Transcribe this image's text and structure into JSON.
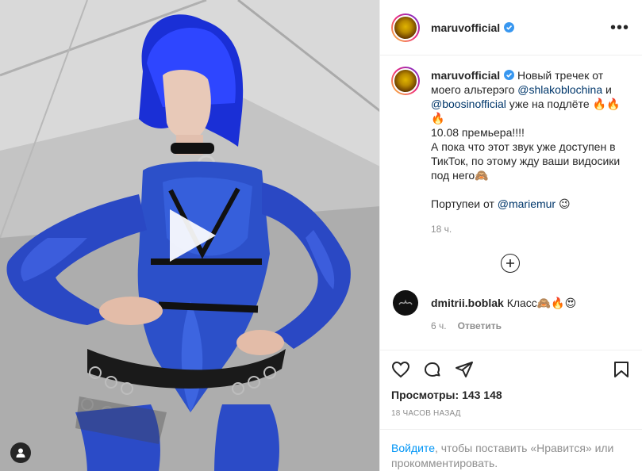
{
  "post": {
    "username": "maruvofficial",
    "verified": true
  },
  "caption": {
    "username": "maruvofficial",
    "text_1": " Новый трeчек от моего альтерэго ",
    "mention_1": "@shlakoblochina",
    "text_2": " и ",
    "mention_2": "@boosinofficial",
    "text_3": " уже на подлёте 🔥🔥🔥",
    "line_2": "10.08 премьера!!!!",
    "line_3": "А пока что этот звук уже доступен в ТикТок, по этому жду ваши видосики под него🙈",
    "line_4_prefix": "Портупеи от ",
    "mention_3": "@mariemur",
    "line_4_suffix": " 😉",
    "time": "18 ч."
  },
  "comment": {
    "username": "dmitrii.boblak",
    "text": "Класс🙈🔥😍",
    "time": "6 ч.",
    "reply_label": "Ответить"
  },
  "stats": {
    "views_label": "Просмотры:",
    "views_count": "143 148",
    "posted_ago": "18 часов назад"
  },
  "login_prompt": {
    "link_label": "Войдите",
    "rest": ", чтобы поставить «Нравится» или прокомментировать."
  },
  "icons": [
    "play-icon",
    "user-tag-icon",
    "verified-icon",
    "more-icon",
    "load-more-icon",
    "heart-icon",
    "comment-icon",
    "share-icon",
    "bookmark-icon"
  ],
  "colors": {
    "link": "#0095f6",
    "mention": "#00376b",
    "verified": "#3897f0",
    "muted": "#8e8e8e"
  }
}
